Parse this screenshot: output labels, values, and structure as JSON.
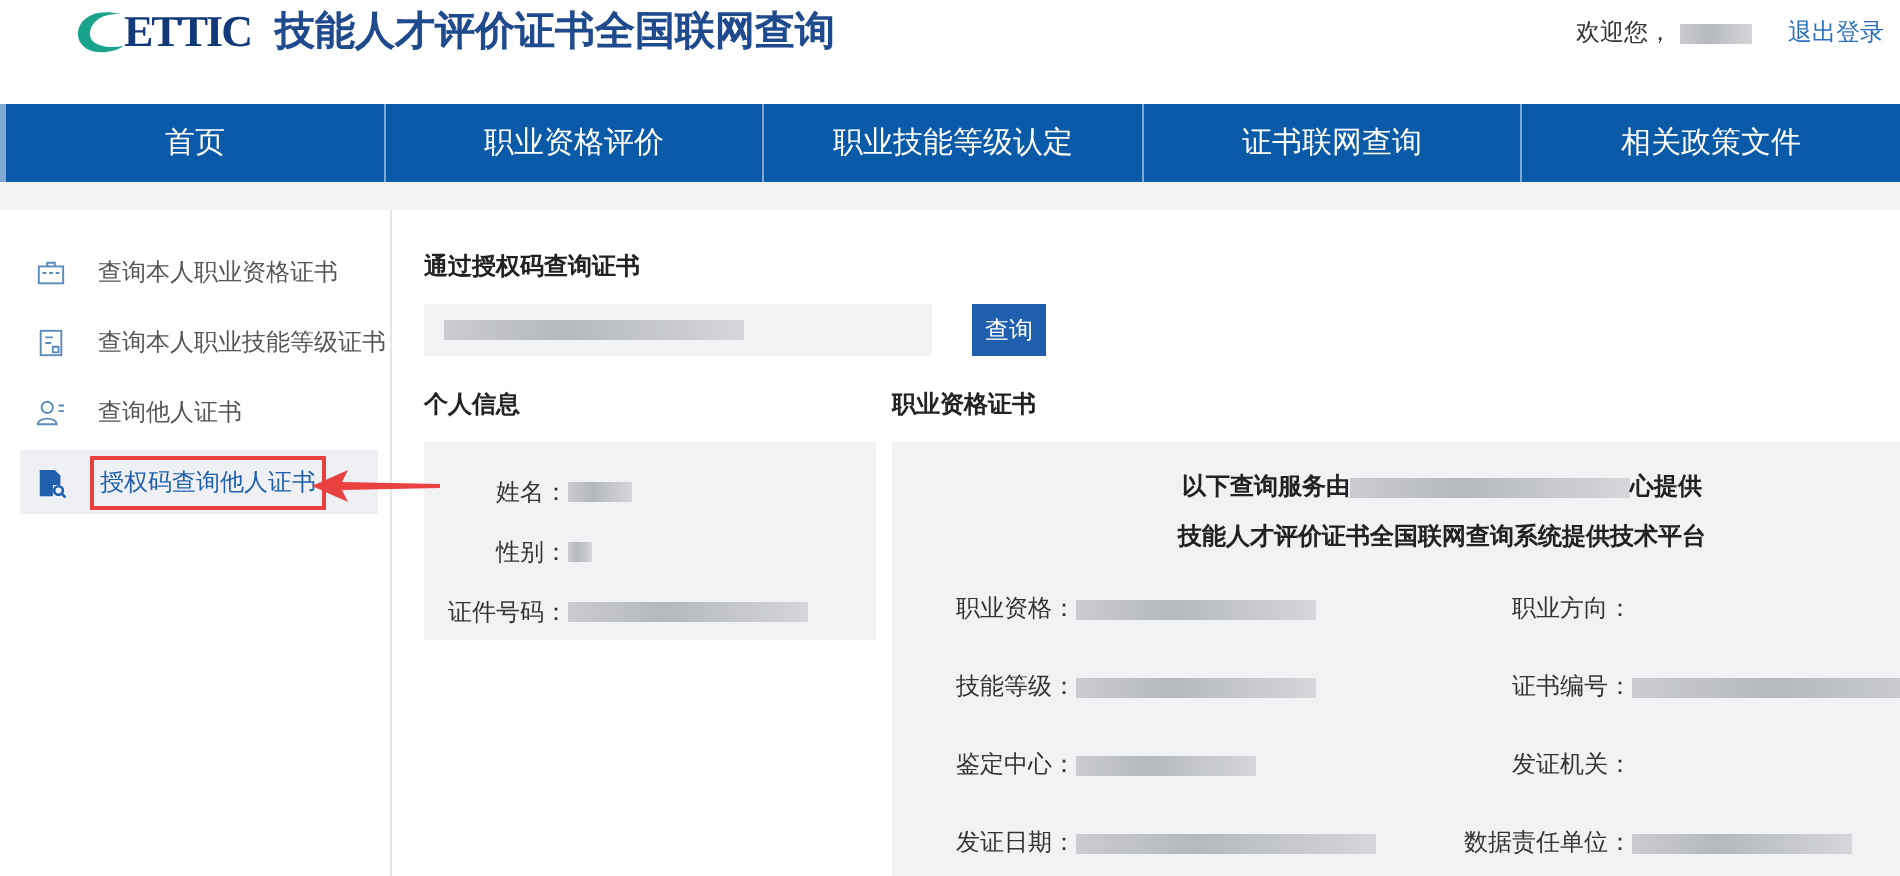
{
  "header": {
    "logo_text": "ETTIC",
    "site_title": "技能人才评价证书全国联网查询",
    "welcome": "欢迎您，",
    "logout": "退出登录"
  },
  "nav": [
    {
      "label": "首页"
    },
    {
      "label": "职业资格评价"
    },
    {
      "label": "职业技能等级认定"
    },
    {
      "label": "证书联网查询"
    },
    {
      "label": "相关政策文件"
    }
  ],
  "sidebar": [
    {
      "label": "查询本人职业资格证书",
      "selected": false,
      "annotated": false
    },
    {
      "label": "查询本人职业技能等级证书",
      "selected": false,
      "annotated": false
    },
    {
      "label": "查询他人证书",
      "selected": false,
      "annotated": false
    },
    {
      "label": "授权码查询他人证书",
      "selected": true,
      "annotated": true
    }
  ],
  "auth_query": {
    "title": "通过授权码查询证书",
    "button": "查询"
  },
  "personal": {
    "title": "个人信息",
    "fields": [
      {
        "label": "姓名："
      },
      {
        "label": "性别："
      },
      {
        "label": "证件号码："
      }
    ]
  },
  "certificate": {
    "title": "职业资格证书",
    "provider_prefix": "以下查询服务由",
    "provider_suffix": "心提供",
    "platform": "技能人才评价证书全国联网查询系统提供技术平台",
    "fields": [
      {
        "label": "职业资格：",
        "redacted": true
      },
      {
        "label": "职业方向：",
        "redacted": false
      },
      {
        "label": "技能等级：",
        "redacted": true
      },
      {
        "label": "证书编号：",
        "redacted": true
      },
      {
        "label": "鉴定中心：",
        "redacted": true
      },
      {
        "label": "发证机关：",
        "redacted": false
      },
      {
        "label": "发证日期：",
        "redacted": true
      },
      {
        "label": "数据责任单位：",
        "redacted": true
      }
    ]
  }
}
